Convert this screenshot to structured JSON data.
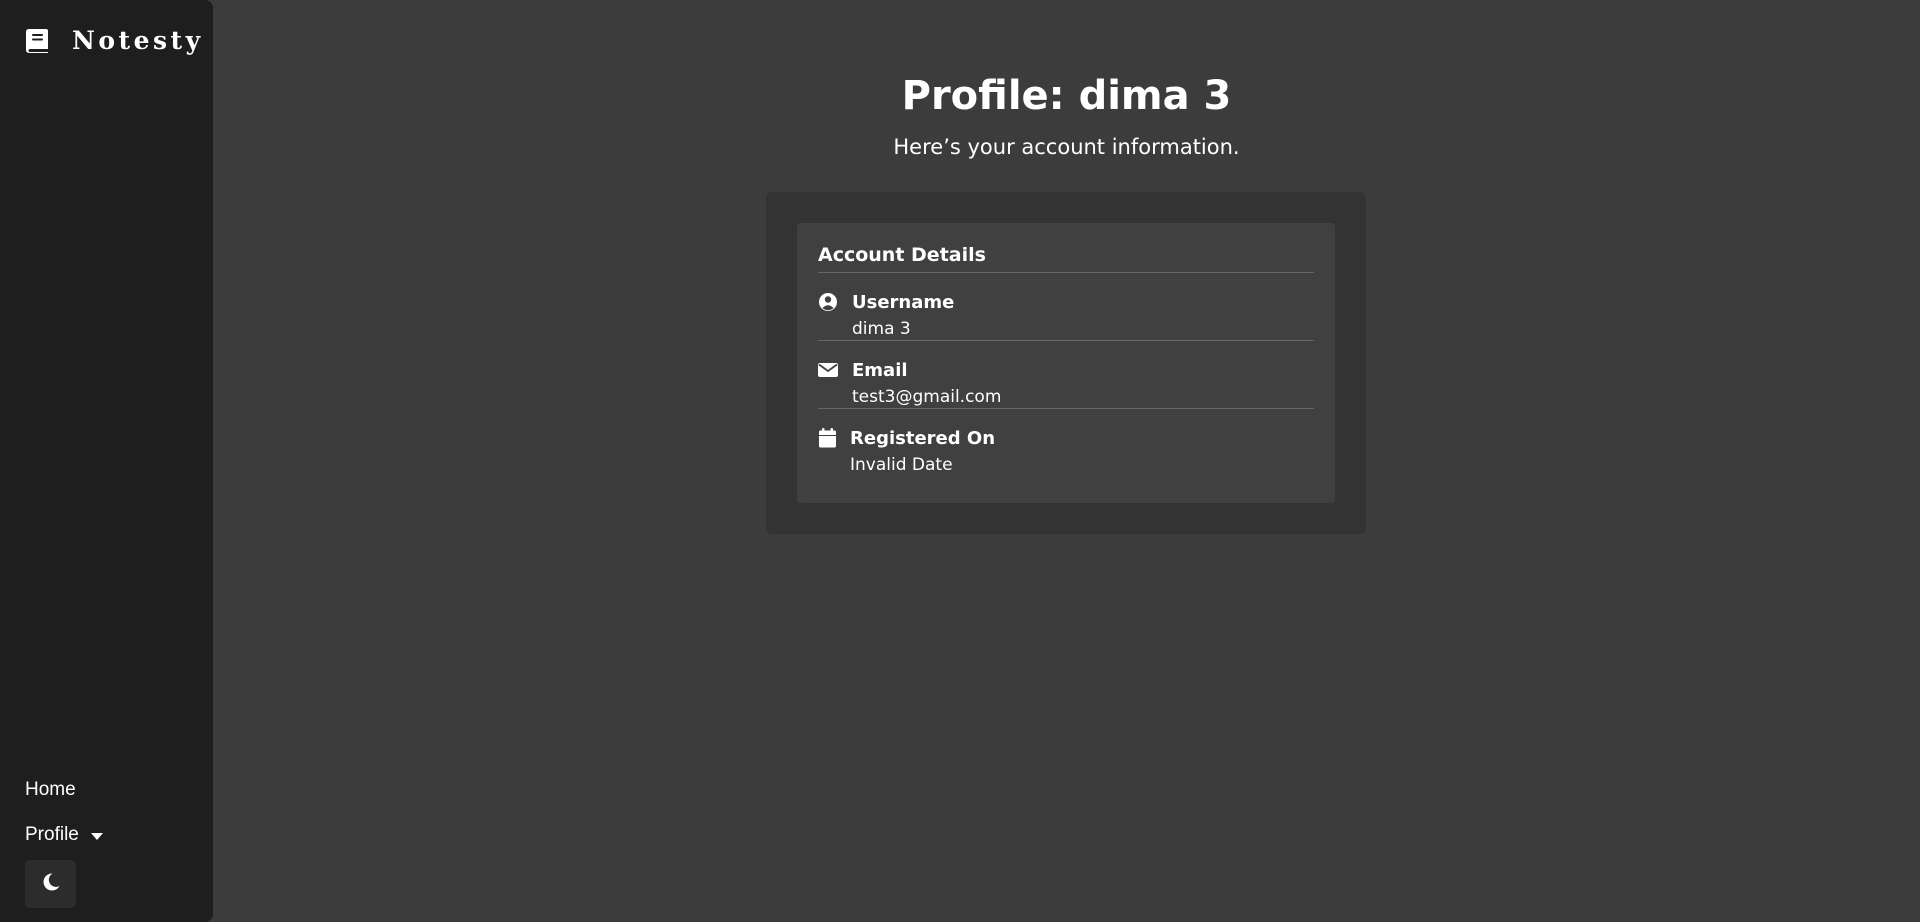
{
  "sidebar": {
    "brand": {
      "name": "Notesty",
      "icon": "book-icon"
    },
    "nav": {
      "home_label": "Home",
      "profile_label": "Profile",
      "profile_icon": "caret-down-icon",
      "theme_icon": "moon-icon"
    }
  },
  "main": {
    "title": "Profile: dima 3",
    "subtitle": "Here’s your account information.",
    "card": {
      "title": "Account Details",
      "fields": [
        {
          "label": "Username",
          "value": "dima 3",
          "icon": "user-circle-icon"
        },
        {
          "label": "Email",
          "value": "test3@gmail.com",
          "icon": "envelope-icon"
        },
        {
          "label": "Registered On",
          "value": "Invalid Date",
          "icon": "calendar-icon"
        }
      ]
    }
  },
  "colors": {
    "sidebar_bg": "#1e1e1e",
    "page_bg": "#3c3c3c",
    "outer_card_bg": "#333333",
    "inner_card_bg": "#404040",
    "text": "#ffffff"
  }
}
